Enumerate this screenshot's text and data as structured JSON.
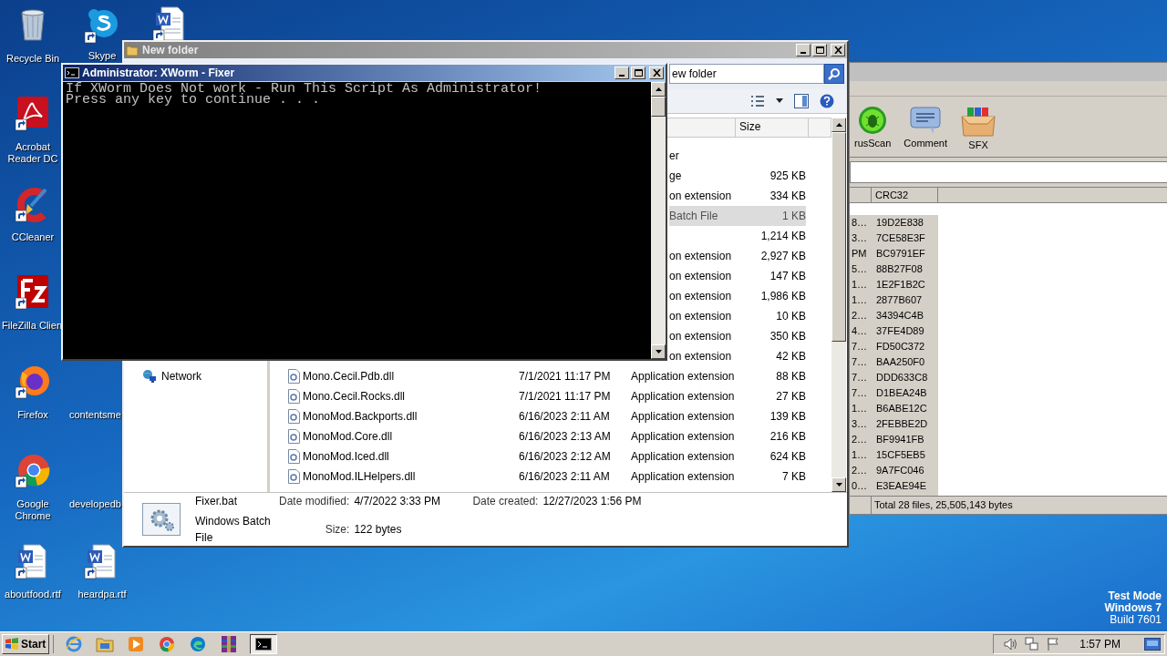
{
  "desktop": {
    "icons": [
      {
        "kind": "trash",
        "label": "Recycle Bin"
      },
      {
        "kind": "chat",
        "label": "Skype"
      },
      {
        "kind": "doc"
      },
      {
        "kind": "pdf",
        "label": "Acrobat Reader DC"
      },
      {
        "kind": "brush",
        "label": "CCleaner"
      },
      {
        "kind": "ftp",
        "label": "FileZilla Clien"
      },
      {
        "kind": "fox",
        "label": "Firefox"
      },
      {
        "kind": "none",
        "label": "contentsme"
      },
      {
        "kind": "chrome",
        "label": "Google Chrome"
      },
      {
        "kind": "none",
        "label": "developedb"
      },
      {
        "kind": "doc",
        "label": "aboutfood.rtf"
      },
      {
        "kind": "doc",
        "label": "heardpa.rtf"
      }
    ],
    "test_mode": [
      "Test Mode",
      "Windows 7",
      "Build 7601"
    ]
  },
  "winrar": {
    "toolbar": [
      {
        "kind": "scan",
        "label": "rusScan"
      },
      {
        "kind": "comment",
        "label": "Comment"
      },
      {
        "kind": "sfx",
        "label": "SFX"
      }
    ],
    "columns": [
      "CRC32"
    ],
    "rows": [
      {
        "column_1": "8…",
        "crc32": "19D2E838"
      },
      {
        "column_1": "3…",
        "crc32": "7CE58E3F"
      },
      {
        "column_1": "PM",
        "crc32": "BC9791EF"
      },
      {
        "column_1": "5…",
        "crc32": "88B27F08"
      },
      {
        "column_1": "1…",
        "crc32": "1E2F1B2C"
      },
      {
        "column_1": "1…",
        "crc32": "2877B607"
      },
      {
        "column_1": "2…",
        "crc32": "34394C4B"
      },
      {
        "column_1": "4…",
        "crc32": "37FE4D89"
      },
      {
        "column_1": "7…",
        "crc32": "FD50C372"
      },
      {
        "column_1": "7…",
        "crc32": "BAA250F0"
      },
      {
        "column_1": "7…",
        "crc32": "DDD633C8"
      },
      {
        "column_1": "7…",
        "crc32": "D1BEA24B"
      },
      {
        "column_1": "1…",
        "crc32": "B6ABE12C"
      },
      {
        "column_1": "3…",
        "crc32": "2FEBBE2D"
      },
      {
        "column_1": "2…",
        "crc32": "BF9941FB"
      },
      {
        "column_1": "1…",
        "crc32": "15CF5EB5"
      },
      {
        "column_1": "2…",
        "crc32": "9A7FC046"
      },
      {
        "column_1": "0…",
        "crc32": "E3EAE94E"
      }
    ],
    "status": "Total 28 files, 25,505,143 bytes"
  },
  "explorer": {
    "title": "New folder",
    "address": "ew folder",
    "columns": [
      "Size"
    ],
    "nav": [
      "Network"
    ],
    "rows": [
      {
        "kind": "partial",
        "type": "er",
        "selected": false
      },
      {
        "kind": "partial",
        "type": "ge",
        "size": "925 KB",
        "selected": false
      },
      {
        "kind": "partial",
        "type": "on extension",
        "size": "334 KB",
        "selected": false
      },
      {
        "kind": "partial",
        "type": "Batch File",
        "size": "1 KB",
        "selected": true
      },
      {
        "kind": "partial",
        "size": "1,214 KB",
        "selected": false
      },
      {
        "kind": "partial",
        "type": "on extension",
        "size": "2,927 KB",
        "selected": false
      },
      {
        "kind": "partial",
        "type": "on extension",
        "size": "147 KB",
        "selected": false
      },
      {
        "kind": "partial",
        "type": "on extension",
        "size": "1,986 KB",
        "selected": false
      },
      {
        "kind": "partial",
        "type": "on extension",
        "size": "10 KB",
        "selected": false
      },
      {
        "kind": "partial",
        "type": "on extension",
        "size": "350 KB",
        "selected": false
      },
      {
        "kind": "partial",
        "type": "on extension",
        "size": "42 KB",
        "selected": false
      },
      {
        "kind": "file",
        "name": "Mono.Cecil.Pdb.dll",
        "date": "7/1/2021 11:17 PM",
        "type": "Application extension",
        "size": "88 KB",
        "selected": false
      },
      {
        "kind": "file",
        "name": "Mono.Cecil.Rocks.dll",
        "date": "7/1/2021 11:17 PM",
        "type": "Application extension",
        "size": "27 KB",
        "selected": false
      },
      {
        "kind": "file",
        "name": "MonoMod.Backports.dll",
        "date": "6/16/2023 2:11 AM",
        "type": "Application extension",
        "size": "139 KB",
        "selected": false
      },
      {
        "kind": "file",
        "name": "MonoMod.Core.dll",
        "date": "6/16/2023 2:13 AM",
        "type": "Application extension",
        "size": "216 KB",
        "selected": false
      },
      {
        "kind": "file",
        "name": "MonoMod.Iced.dll",
        "date": "6/16/2023 2:12 AM",
        "type": "Application extension",
        "size": "624 KB",
        "selected": false
      },
      {
        "kind": "file",
        "name": "MonoMod.ILHelpers.dll",
        "date": "6/16/2023 2:11 AM",
        "type": "Application extension",
        "size": "7 KB",
        "selected": false
      }
    ],
    "details": {
      "name": "Fixer.bat",
      "type": "Windows Batch File",
      "fields": [
        {
          "label": "Date modified:",
          "value": "4/7/2022 3:33 PM"
        },
        {
          "label": "Size:",
          "value": "122 bytes"
        },
        {
          "label": "Date created:",
          "value": "12/27/2023 1:56 PM"
        }
      ]
    }
  },
  "console": {
    "title": "Administrator: XWorm - Fixer",
    "lines": [
      "If XWorm Does Not work - Run This Script As Administrator!",
      "Press any key to continue . . ."
    ]
  },
  "taskbar": {
    "start": "Start",
    "apps": [
      {
        "kind": "ie",
        "selected": false
      },
      {
        "kind": "folder",
        "selected": false
      },
      {
        "kind": "media",
        "selected": false
      },
      {
        "kind": "chrome",
        "selected": false
      },
      {
        "kind": "edge",
        "selected": false
      },
      {
        "kind": "archive",
        "selected": false
      },
      {
        "kind": "terminal",
        "selected": true
      }
    ],
    "time": "1:57 PM"
  }
}
